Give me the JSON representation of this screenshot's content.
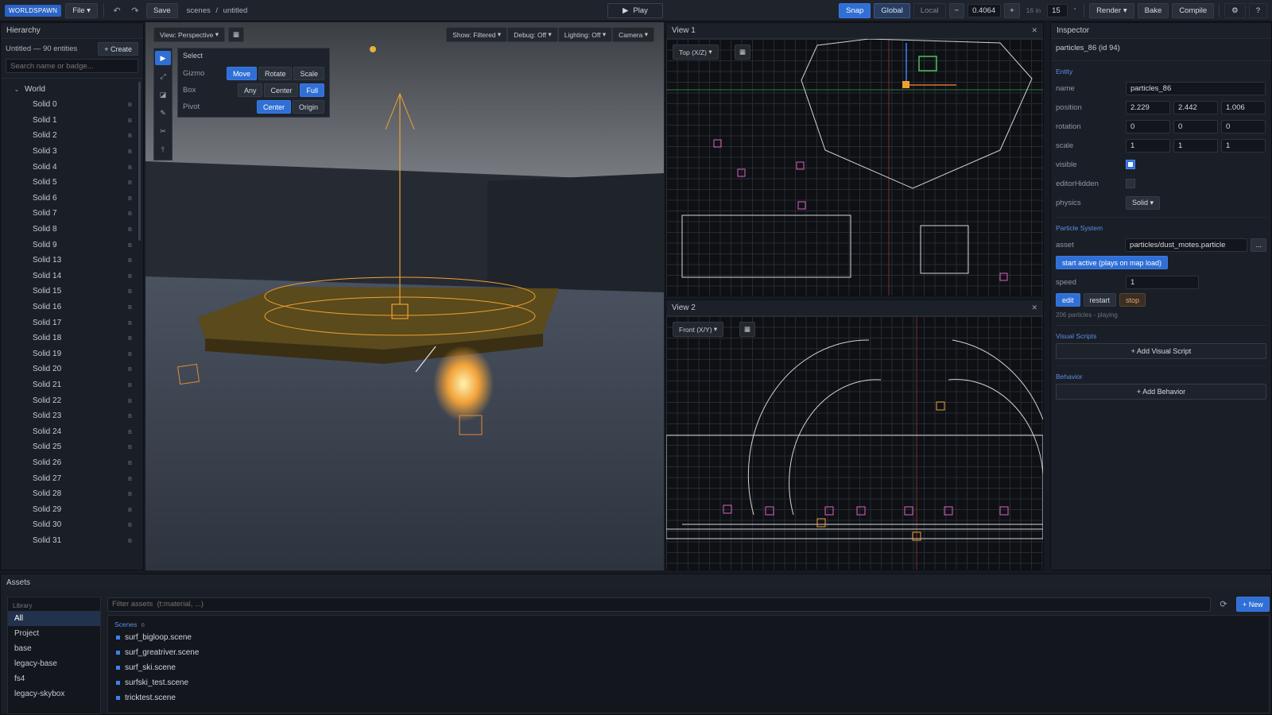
{
  "toolbar": {
    "brand": "WORLDSPAWN",
    "file": "File",
    "save": "Save",
    "breadcrumb_root": "scenes",
    "breadcrumb_sep": "/",
    "breadcrumb_leaf": "untitled",
    "play": "Play",
    "snap": "Snap",
    "global": "Global",
    "local": "Local",
    "snap_value": "0.4064",
    "snap_unit": "16 in",
    "angle_value": "15",
    "render": "Render",
    "bake": "Bake",
    "compile": "Compile",
    "help": "?"
  },
  "hierarchy": {
    "title": "Hierarchy",
    "summary": "Untitled — 90 entities",
    "create": "+ Create",
    "search_placeholder": "Search name or badge...",
    "root": "World",
    "badge": "B",
    "items": [
      "Solid 0",
      "Solid 1",
      "Solid 2",
      "Solid 3",
      "Solid 4",
      "Solid 5",
      "Solid 6",
      "Solid 7",
      "Solid 8",
      "Solid 9",
      "Solid 13",
      "Solid 14",
      "Solid 15",
      "Solid 16",
      "Solid 17",
      "Solid 18",
      "Solid 19",
      "Solid 20",
      "Solid 21",
      "Solid 22",
      "Solid 23",
      "Solid 24",
      "Solid 25",
      "Solid 26",
      "Solid 27",
      "Solid 28",
      "Solid 29",
      "Solid 30",
      "Solid 31"
    ]
  },
  "viewport3d": {
    "view_mode": "View: Perspective",
    "show": "Show: Filtered",
    "debug": "Debug: Off",
    "lighting": "Lighting: Off",
    "camera": "Camera",
    "select_panel": {
      "title": "Select",
      "gizmo_label": "Gizmo",
      "gizmo_options": [
        "Move",
        "Rotate",
        "Scale"
      ],
      "box_label": "Box",
      "box_options": [
        "Any",
        "Center",
        "Full"
      ],
      "pivot_label": "Pivot",
      "pivot_options": [
        "Center",
        "Origin"
      ]
    }
  },
  "view1": {
    "title": "View 1",
    "mode": "Top (X/Z)"
  },
  "view2": {
    "title": "View 2",
    "mode": "Front (X/Y)"
  },
  "inspector": {
    "title": "Inspector",
    "subtitle": "particles_86 (id 94)",
    "entity_section": "Entity",
    "name_label": "name",
    "name_value": "particles_86",
    "position_label": "position",
    "position": [
      "2.229",
      "2.442",
      "1.006"
    ],
    "rotation_label": "rotation",
    "rotation": [
      "0",
      "0",
      "0"
    ],
    "scale_label": "scale",
    "scale": [
      "1",
      "1",
      "1"
    ],
    "visible_label": "visible",
    "visible": true,
    "editor_hidden_label": "editorHidden",
    "editor_hidden": false,
    "physics_label": "physics",
    "physics_value": "Solid",
    "particle_section": "Particle System",
    "asset_label": "asset",
    "asset_value": "particles/dust_motes.particle",
    "asset_more": "...",
    "start_active": "start active (plays on map load)",
    "speed_label": "speed",
    "speed_value": "1",
    "edit": "edit",
    "restart": "restart",
    "stop": "stop",
    "status": "206 particles - playing",
    "visual_scripts_section": "Visual Scripts",
    "add_visual_script": "+ Add Visual Script",
    "behavior_section": "Behavior",
    "add_behavior": "+ Add Behavior"
  },
  "assets": {
    "title": "Assets",
    "library_label": "Library",
    "library": [
      "All",
      "Project",
      "base",
      "legacy-base",
      "fs4",
      "legacy-skybox"
    ],
    "filter_placeholder": "Filter assets  (t:material, ...)",
    "new": "+ New",
    "scenes_label": "Scenes",
    "scenes_count": "6",
    "scenes": [
      "surf_bigloop.scene",
      "surf_greatriver.scene",
      "surf_ski.scene",
      "surfski_test.scene",
      "tricktest.scene"
    ]
  },
  "colors": {
    "accent": "#2f6fd6",
    "selection": "#f0a030",
    "brush": "#e060c0"
  }
}
